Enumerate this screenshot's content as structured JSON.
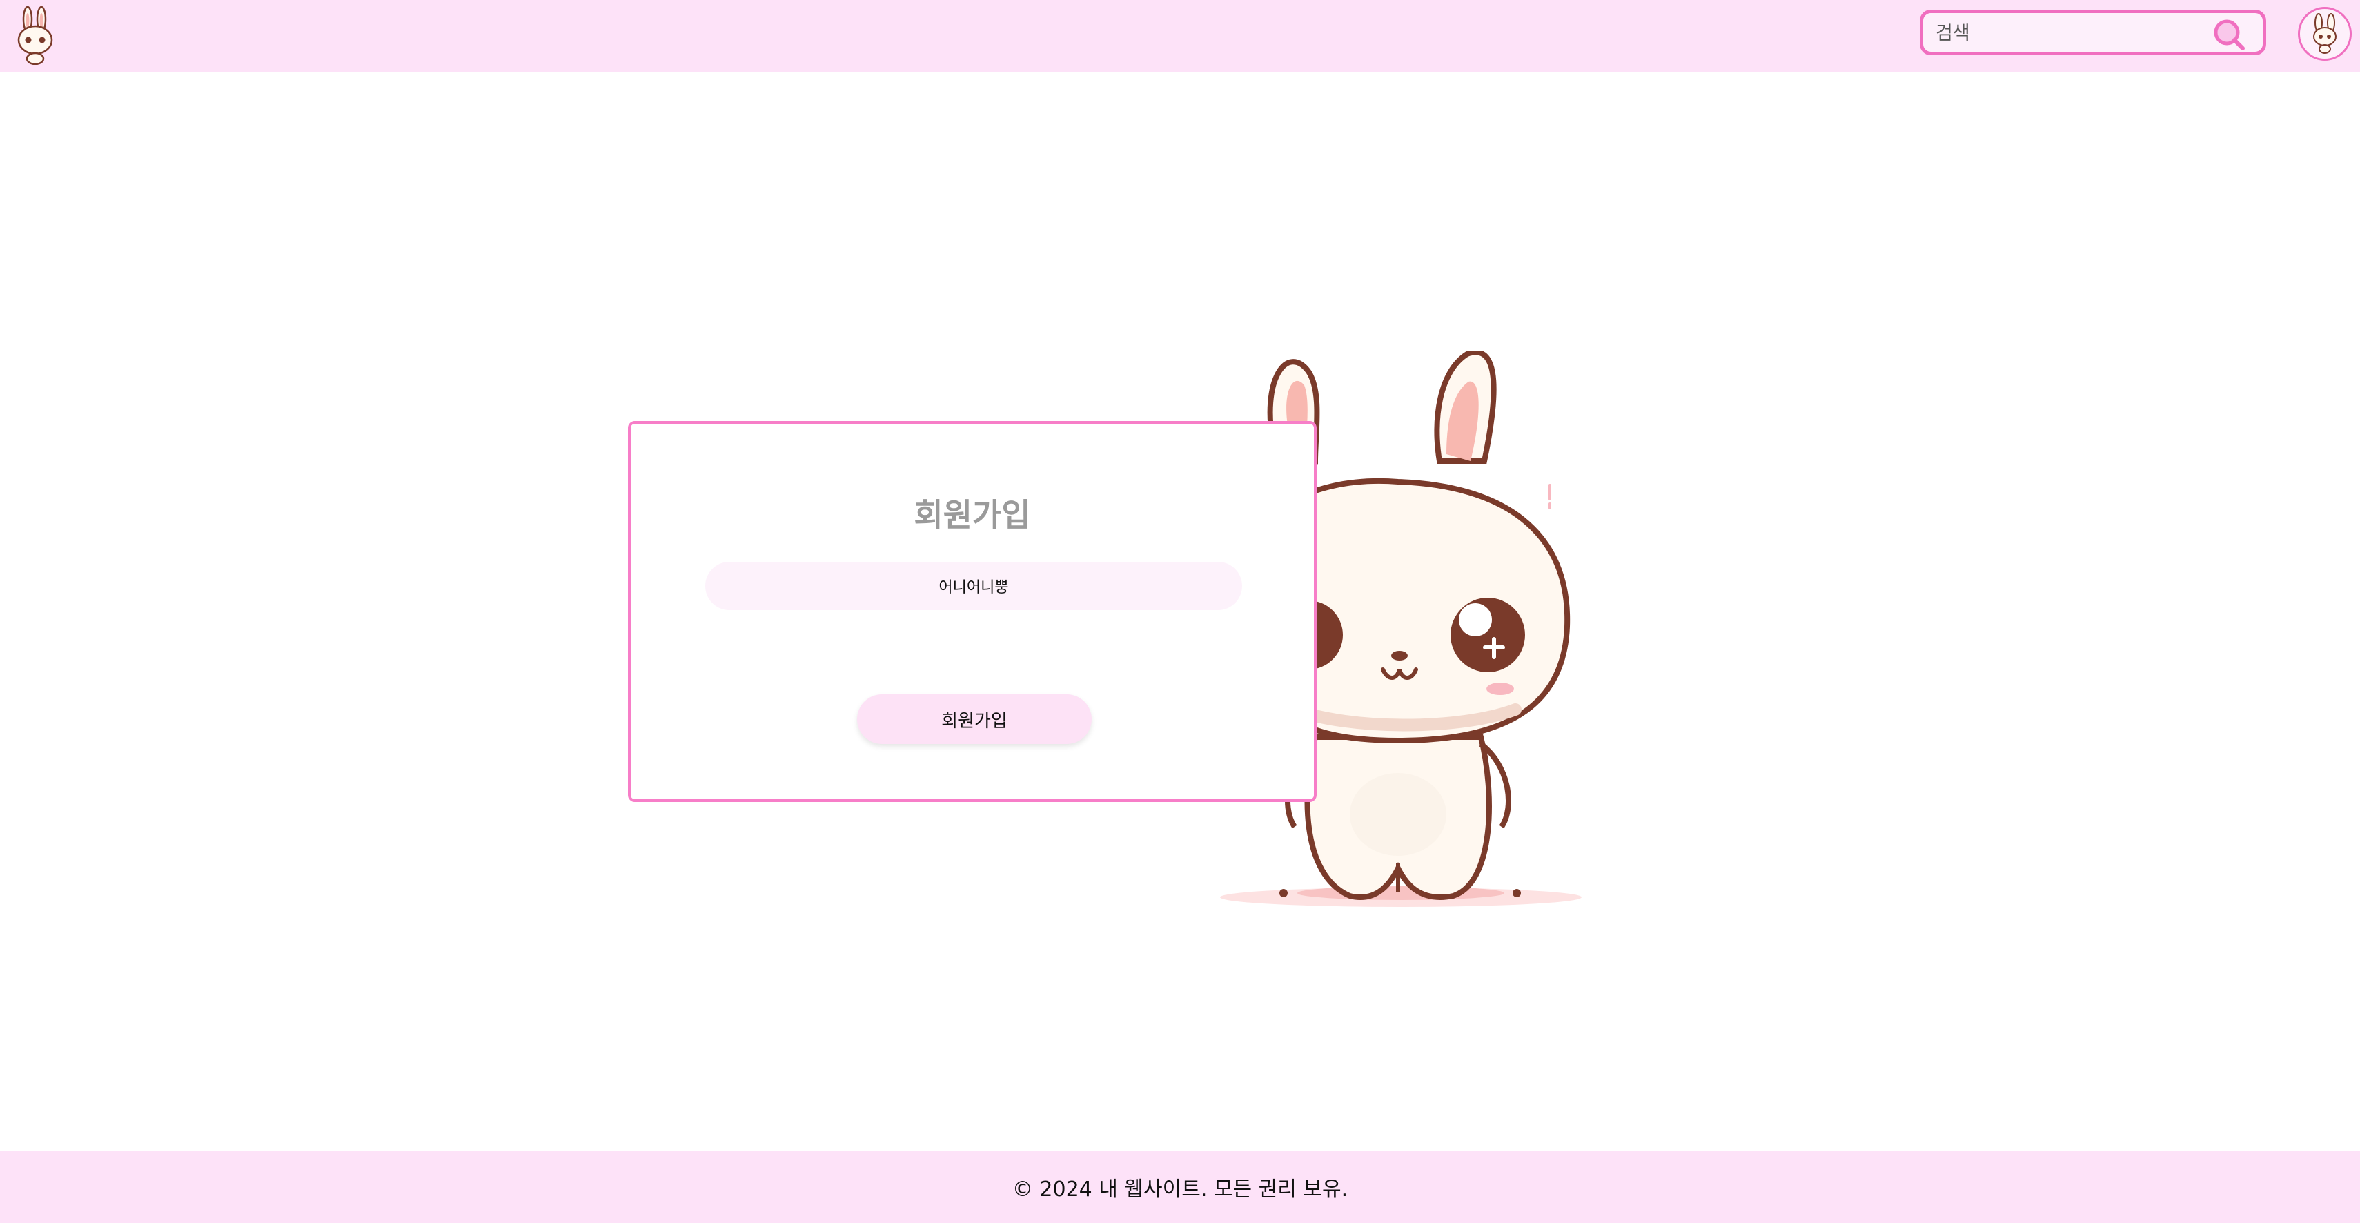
{
  "header": {
    "search": {
      "placeholder": "검색",
      "icon": "search-icon"
    },
    "logo_icon": "bunny-logo-icon",
    "avatar_icon": "bunny-avatar-icon"
  },
  "signup_form": {
    "title": "회원가입",
    "name_value": "어니어니뿡",
    "submit_label": "회원가입"
  },
  "illustration": {
    "icon": "bunny-illustration"
  },
  "footer": {
    "copyright": "© 2024 내 웹사이트. 모든 권리 보유."
  },
  "colors": {
    "accent": "#f06fc0",
    "header_bg": "#fde2f8",
    "field_bg": "#fdf2fb",
    "button_bg": "#fde2f6",
    "title_gray": "#9a9a9a",
    "bunny_outline": "#7a3a2a"
  }
}
